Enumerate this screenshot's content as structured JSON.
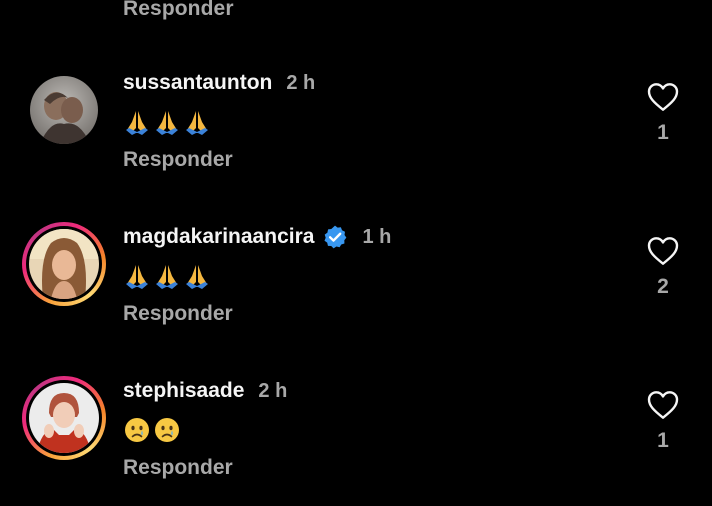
{
  "top_reply_label": "Responder",
  "comments": [
    {
      "username": "sussantaunton",
      "verified": false,
      "time": "2 h",
      "emojis": [
        "pray-emoji",
        "pray-emoji",
        "pray-emoji"
      ],
      "reply_label": "Responder",
      "like_count": "1",
      "story_ring": false
    },
    {
      "username": "magdakarinaancira",
      "verified": true,
      "time": "1 h",
      "emojis": [
        "pray-emoji",
        "pray-emoji",
        "pray-emoji"
      ],
      "reply_label": "Responder",
      "like_count": "2",
      "story_ring": true
    },
    {
      "username": "stephisaade",
      "verified": false,
      "time": "2 h",
      "emojis": [
        "crying-face-emoji",
        "crying-face-emoji"
      ],
      "reply_label": "Responder",
      "like_count": "1",
      "story_ring": true
    }
  ],
  "colors": {
    "background": "#000000",
    "primary_text": "#f5f5f5",
    "secondary_text": "#a8a8a8",
    "verified_blue": "#3897f0"
  }
}
